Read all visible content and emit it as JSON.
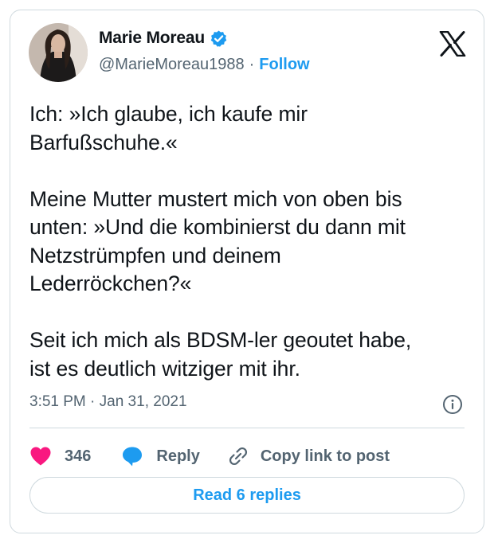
{
  "author": {
    "name": "Marie Moreau",
    "handle": "@MarieMoreau1988",
    "separator": "·",
    "follow_label": "Follow"
  },
  "tweet": {
    "text": "Ich: »Ich glaube, ich kaufe mir\nBarfußschuhe.«\n\nMeine Mutter mustert mich von oben bis\nunten: »Und die kombinierst du dann mit\nNetzstrümpfen und deinem\nLederröckchen?«\n\nSeit ich mich als BDSM-ler geoutet habe,\nist es deutlich witziger mit ihr.",
    "timestamp": "3:51 PM · Jan 31, 2021"
  },
  "actions": {
    "likes_count": "346",
    "reply_label": "Reply",
    "copy_label": "Copy link to post"
  },
  "read_replies_label": "Read 6 replies",
  "colors": {
    "accent": "#1d9bf0",
    "like": "#f91880",
    "text": "#0f1419",
    "muted": "#536471",
    "border": "#cfd9de"
  },
  "icons": [
    "verified-badge-icon",
    "x-logo-icon",
    "info-icon",
    "heart-icon",
    "reply-bubble-icon",
    "link-icon"
  ]
}
